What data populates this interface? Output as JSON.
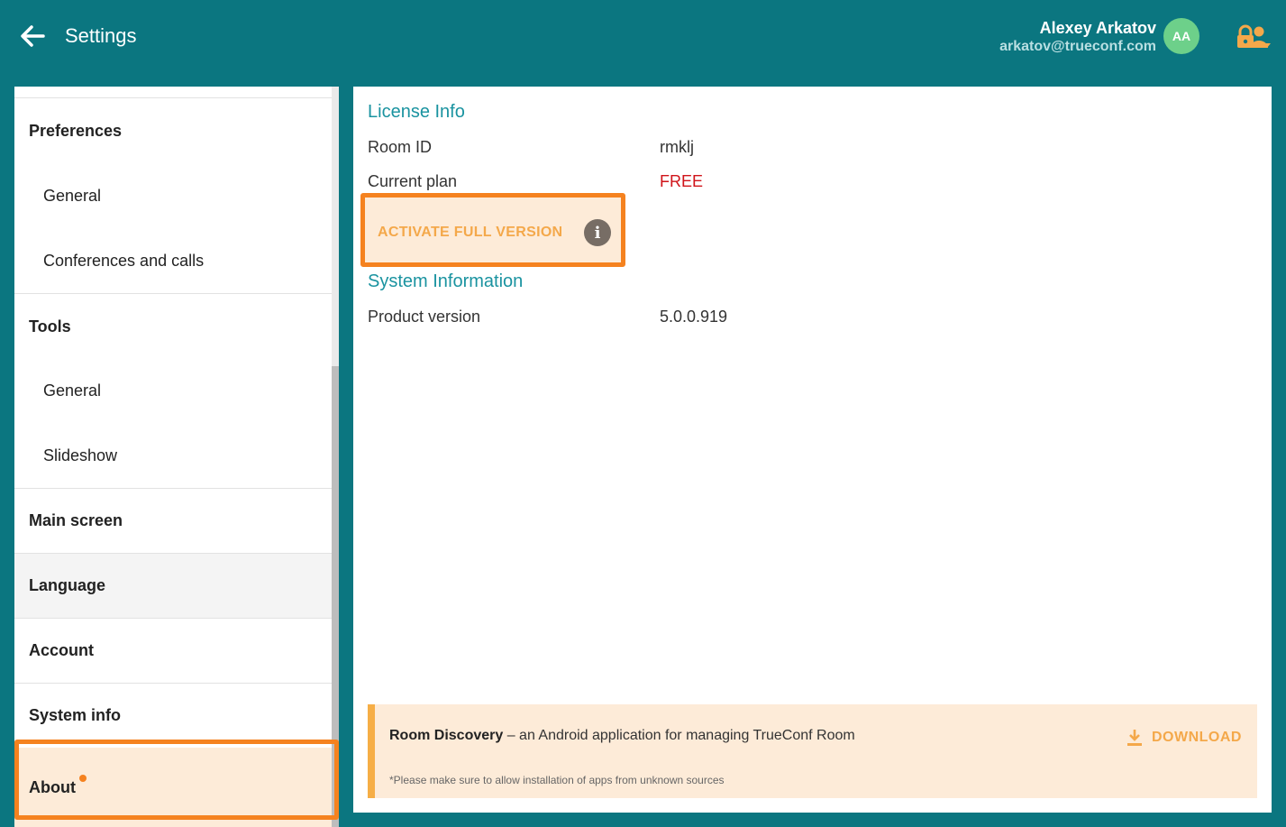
{
  "header": {
    "title": "Settings",
    "user_name": "Alexey Arkatov",
    "user_email": "arkatov@trueconf.com",
    "avatar_initials": "AA"
  },
  "sidebar": {
    "items": [
      {
        "label": "Preferences",
        "kind": "header"
      },
      {
        "label": "General",
        "kind": "sub"
      },
      {
        "label": "Conferences and calls",
        "kind": "sub"
      },
      {
        "label": "Tools",
        "kind": "header"
      },
      {
        "label": "General",
        "kind": "sub"
      },
      {
        "label": "Slideshow",
        "kind": "sub"
      },
      {
        "label": "Main screen",
        "kind": "header"
      },
      {
        "label": "Language",
        "kind": "header"
      },
      {
        "label": "Account",
        "kind": "header"
      },
      {
        "label": "System info",
        "kind": "header"
      },
      {
        "label": "About",
        "kind": "header"
      }
    ]
  },
  "content": {
    "license_title": "License Info",
    "room_id_label": "Room ID",
    "room_id_value": "rmklj",
    "plan_label": "Current plan",
    "plan_value": "FREE",
    "activate_label": "ACTIVATE FULL VERSION",
    "system_title": "System Information",
    "version_label": "Product version",
    "version_value": "5.0.0.919"
  },
  "banner": {
    "app_name": "Room Discovery",
    "description": " – an Android application for managing TrueConf Room",
    "note": "*Please make sure to allow installation of apps from unknown sources",
    "download_label": "DOWNLOAD"
  },
  "colors": {
    "header_bg": "#0b7680",
    "accent_teal": "#1a93a0",
    "highlight_orange": "#f5821f",
    "plan_red": "#d0141a"
  }
}
